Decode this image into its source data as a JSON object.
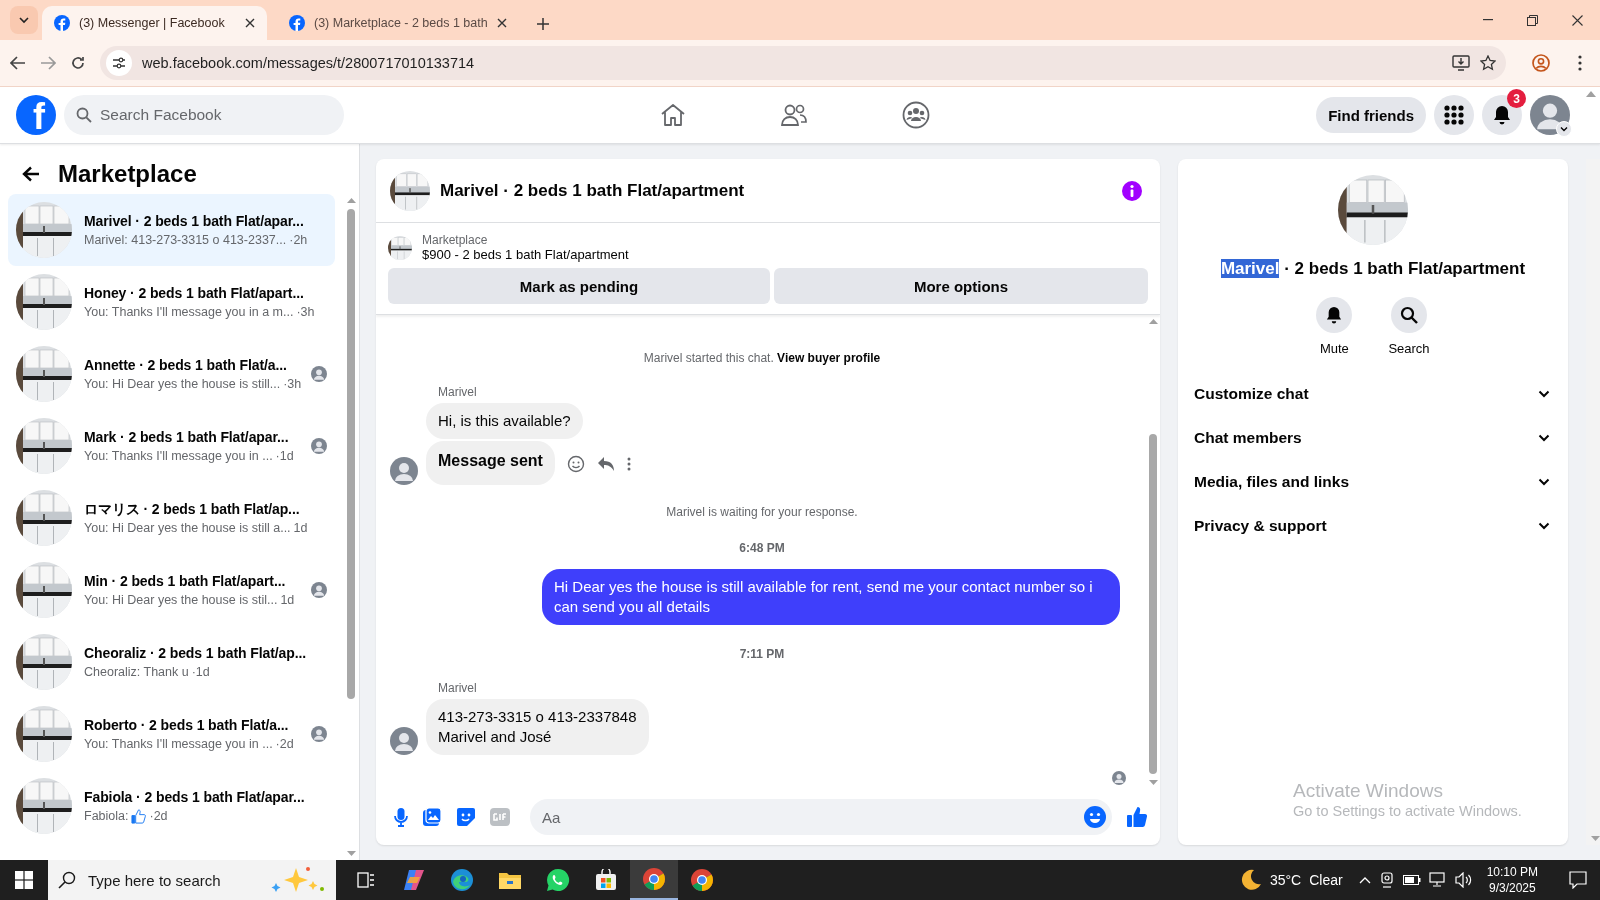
{
  "browser": {
    "tabs": [
      {
        "title": "(3) Messenger | Facebook",
        "selected": true
      },
      {
        "title": "(3) Marketplace - 2 beds 1 bath",
        "selected": false
      }
    ],
    "url": "web.facebook.com/messages/t/2800717010133714"
  },
  "header": {
    "logo": "f",
    "search_placeholder": "Search Facebook",
    "find_friends": "Find friends",
    "notification_count": "3"
  },
  "sidebar": {
    "title": "Marketplace",
    "conversations": [
      {
        "name": "Marivel · 2 beds 1 bath Flat/apar...",
        "preview": "Marivel: 413-273-3315 o 413-2337...",
        "time": "·2h",
        "selected": true,
        "read_receipt": false,
        "like_icon": false
      },
      {
        "name": "Honey · 2 beds 1 bath Flat/apart...",
        "preview": "You: Thanks I'll message you in a m...",
        "time": "·3h",
        "selected": false,
        "read_receipt": false,
        "like_icon": false
      },
      {
        "name": "Annette · 2 beds 1 bath Flat/a...",
        "preview": "You: Hi Dear yes the house is still...",
        "time": "·3h",
        "selected": false,
        "read_receipt": true,
        "like_icon": false
      },
      {
        "name": "Mark · 2 beds 1 bath Flat/apar...",
        "preview": "You: Thanks I'll message you in ...",
        "time": "·1d",
        "selected": false,
        "read_receipt": true,
        "like_icon": false
      },
      {
        "name": "ロマリス · 2 beds 1 bath Flat/ap...",
        "preview": "You: Hi Dear yes the house is still a...",
        "time": "1d",
        "selected": false,
        "read_receipt": false,
        "like_icon": false
      },
      {
        "name": "Min · 2 beds 1 bath Flat/apart...",
        "preview": "You: Hi Dear yes the house is stil...",
        "time": "1d",
        "selected": false,
        "read_receipt": true,
        "like_icon": false
      },
      {
        "name": "Cheoraliz · 2 beds 1 bath Flat/ap...",
        "preview": "Cheoraliz: Thank u",
        "time": "·1d",
        "selected": false,
        "read_receipt": false,
        "like_icon": false
      },
      {
        "name": "Roberto · 2 beds 1 bath Flat/a...",
        "preview": "You: Thanks I'll message you in ...",
        "time": "·2d",
        "selected": false,
        "read_receipt": true,
        "like_icon": false
      },
      {
        "name": "Fabiola · 2 beds 1 bath Flat/apar...",
        "preview": "Fabiola:",
        "time": "·2d",
        "selected": false,
        "read_receipt": false,
        "like_icon": true
      }
    ]
  },
  "chat": {
    "title": "Marivel · 2 beds 1 bath Flat/apartment",
    "listing": {
      "source": "Marketplace",
      "title": "$900 - 2 beds 1 bath Flat/apartment",
      "buttons": [
        "Mark as pending",
        "More options"
      ]
    },
    "messages": [
      {
        "kind": "notice",
        "text": "Marivel started this chat.",
        "link": "View buyer profile"
      },
      {
        "kind": "sender",
        "text": "Marivel"
      },
      {
        "kind": "incoming",
        "text": "Hi, is this available?",
        "avatar": false,
        "hovered": false
      },
      {
        "kind": "incoming",
        "text": "Message sent",
        "avatar": true,
        "hovered": true
      },
      {
        "kind": "notice",
        "text": "Marivel is waiting for your response."
      },
      {
        "kind": "time",
        "text": "6:48 PM"
      },
      {
        "kind": "outgoing",
        "text": "Hi Dear yes the house is still available for rent, send me your contact number so i can send you all details"
      },
      {
        "kind": "time",
        "text": "7:11 PM"
      },
      {
        "kind": "sender",
        "text": "Marivel"
      },
      {
        "kind": "incoming",
        "text": "413-273-3315 o 413-2337848\nMarivel and José",
        "avatar": true,
        "hovered": false
      }
    ],
    "seen": true,
    "composer": {
      "placeholder": "Aa"
    }
  },
  "info": {
    "name": "Marivel",
    "name_selected": true,
    "rest": "· 2 beds 1 bath Flat/apartment",
    "actions": [
      {
        "kind": "bell",
        "label": "Mute"
      },
      {
        "kind": "search",
        "label": "Search"
      }
    ],
    "sections": [
      {
        "label": "Customize chat",
        "expanded": false
      },
      {
        "label": "Chat members",
        "expanded": false
      },
      {
        "label": "Media, files and links",
        "expanded": false
      },
      {
        "label": "Privacy & support",
        "expanded": false
      }
    ]
  },
  "windows_notice": {
    "title": "Activate Windows",
    "text": "Go to Settings to activate Windows."
  },
  "taskbar": {
    "search_placeholder": "Type here to search",
    "apps": [
      {
        "kind": "taskview",
        "active": false
      },
      {
        "kind": "copilot",
        "active": false
      },
      {
        "kind": "edge",
        "active": false
      },
      {
        "kind": "files",
        "active": false
      },
      {
        "kind": "whatsapp",
        "active": false
      },
      {
        "kind": "store",
        "active": false
      },
      {
        "kind": "chrome",
        "active": true
      },
      {
        "kind": "chrome",
        "active": false
      }
    ],
    "temperature": "35°C",
    "weather": "Clear",
    "time": "10:10 PM",
    "date": "9/3/2025"
  }
}
